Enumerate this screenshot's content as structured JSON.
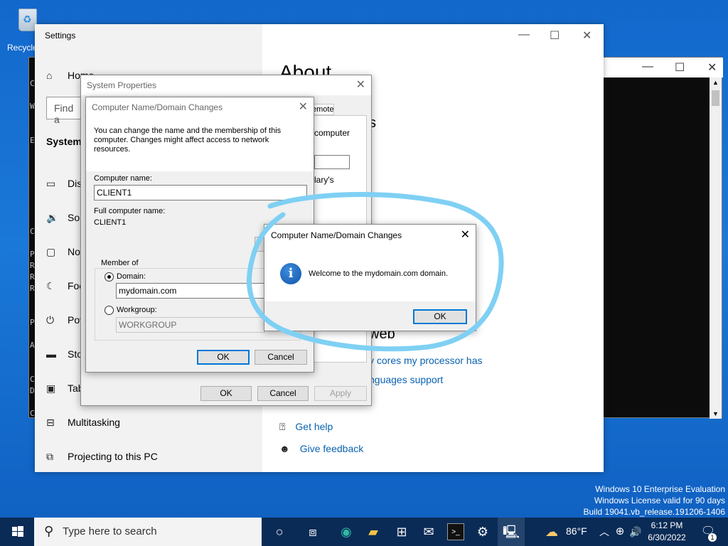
{
  "desktop": {
    "recycle_bin_label": "Recycle",
    "watermark": {
      "line1": "Windows 10 Enterprise Evaluation",
      "line2": "Windows License valid for 90 days",
      "line3": "Build 19041.vb_release.191206-1406"
    }
  },
  "console": {
    "left_chars": [
      "C",
      "W",
      "E",
      "C",
      "P",
      "R",
      "R",
      "R",
      "P",
      "A",
      "C",
      "D",
      "C"
    ]
  },
  "settings": {
    "title": "Settings",
    "nav": {
      "home": "Home",
      "search_placeholder": "Find a",
      "system": "System",
      "display": "Dis",
      "sound": "So",
      "notifications": "No",
      "focus": "Foc",
      "power": "Pov",
      "storage": "Sto",
      "tablet": "Tab",
      "multitasking": "Multitasking",
      "projecting": "Projecting to this PC"
    },
    "content": {
      "heading": "About",
      "related_fragment": "s",
      "web_fragment": "web",
      "link_cores": "y cores my processor has",
      "link_languages": "nguages support",
      "get_help": "Get help",
      "give_feedback": "Give feedback"
    }
  },
  "system_properties": {
    "title": "System Properties",
    "tab_remote": "emote",
    "text_computer": "computer",
    "text_lary": "lary's",
    "ok": "OK",
    "cancel": "Cancel",
    "apply": "Apply"
  },
  "name_changes": {
    "title": "Computer Name/Domain Changes",
    "description": "You can change the name and the membership of this computer. Changes might affect access to network resources.",
    "computer_name_label": "Computer name:",
    "computer_name_value": "CLIENT1",
    "full_name_label": "Full computer name:",
    "full_name_value": "CLIENT1",
    "member_of": "Member of",
    "domain_label": "Domain:",
    "domain_value": "mydomain.com",
    "workgroup_label": "Workgroup:",
    "workgroup_value": "WORKGROUP",
    "ok": "OK",
    "cancel": "Cancel"
  },
  "message_box": {
    "title": "Computer Name/Domain Changes",
    "message": "Welcome to the mydomain.com domain.",
    "ok": "OK",
    "icon": "info-icon"
  },
  "taskbar": {
    "search_placeholder": "Type here to search",
    "weather": "86°F",
    "time": "6:12 PM",
    "date": "6/30/2022",
    "notification_count": "1"
  },
  "colors": {
    "accent": "#0078d7",
    "annotation": "#7fd0f4",
    "link": "#0a62b0"
  }
}
